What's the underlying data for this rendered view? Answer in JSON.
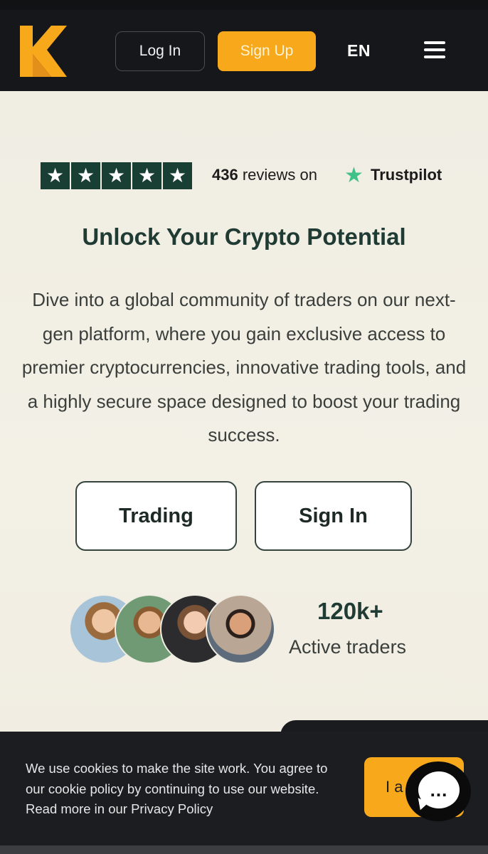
{
  "header": {
    "logo_icon": "k-logo-icon",
    "login_label": "Log In",
    "signup_label": "Sign Up",
    "language": "EN",
    "menu_icon": "hamburger-menu-icon"
  },
  "rating": {
    "stars": 5,
    "count": "436",
    "reviews_text": " reviews on",
    "provider": "Trustpilot",
    "star_color": "#193f35",
    "provider_star_color": "#3fc28a"
  },
  "hero": {
    "title": "Unlock Your Crypto Potential",
    "description": "Dive into a global community of traders on our next-gen platform, where you gain exclusive access to premier cryptocurrencies, innovative trading tools, and a highly secure space designed to boost your trading success."
  },
  "actions": {
    "trading_label": "Trading",
    "signin_label": "Sign In"
  },
  "traders": {
    "count": "120k+",
    "label": "Active traders"
  },
  "cookie": {
    "text": "We use cookies to make the site work. You agree to our cookie policy by continuing to use our website. Read more in our Privacy Policy",
    "accept_label": "I a",
    "chat_icon": "chat-bubble-icon",
    "chat_glyph": "..."
  },
  "colors": {
    "accent": "#f7a81b",
    "dark": "#16171b",
    "heading": "#1f3b33"
  }
}
